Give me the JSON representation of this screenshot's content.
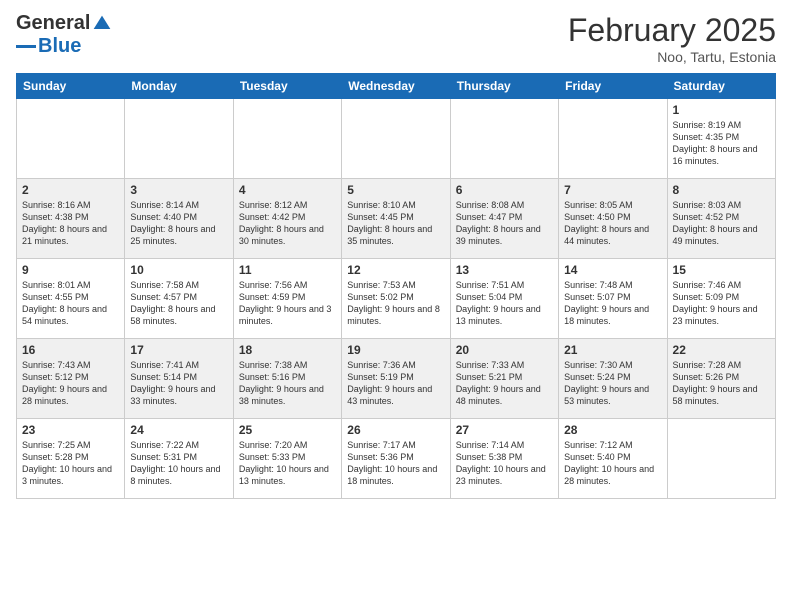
{
  "logo": {
    "general": "General",
    "blue": "Blue"
  },
  "title": "February 2025",
  "subtitle": "Noo, Tartu, Estonia",
  "days_of_week": [
    "Sunday",
    "Monday",
    "Tuesday",
    "Wednesday",
    "Thursday",
    "Friday",
    "Saturday"
  ],
  "weeks": [
    [
      {
        "day": "",
        "info": ""
      },
      {
        "day": "",
        "info": ""
      },
      {
        "day": "",
        "info": ""
      },
      {
        "day": "",
        "info": ""
      },
      {
        "day": "",
        "info": ""
      },
      {
        "day": "",
        "info": ""
      },
      {
        "day": "1",
        "info": "Sunrise: 8:19 AM\nSunset: 4:35 PM\nDaylight: 8 hours and 16 minutes."
      }
    ],
    [
      {
        "day": "2",
        "info": "Sunrise: 8:16 AM\nSunset: 4:38 PM\nDaylight: 8 hours and 21 minutes."
      },
      {
        "day": "3",
        "info": "Sunrise: 8:14 AM\nSunset: 4:40 PM\nDaylight: 8 hours and 25 minutes."
      },
      {
        "day": "4",
        "info": "Sunrise: 8:12 AM\nSunset: 4:42 PM\nDaylight: 8 hours and 30 minutes."
      },
      {
        "day": "5",
        "info": "Sunrise: 8:10 AM\nSunset: 4:45 PM\nDaylight: 8 hours and 35 minutes."
      },
      {
        "day": "6",
        "info": "Sunrise: 8:08 AM\nSunset: 4:47 PM\nDaylight: 8 hours and 39 minutes."
      },
      {
        "day": "7",
        "info": "Sunrise: 8:05 AM\nSunset: 4:50 PM\nDaylight: 8 hours and 44 minutes."
      },
      {
        "day": "8",
        "info": "Sunrise: 8:03 AM\nSunset: 4:52 PM\nDaylight: 8 hours and 49 minutes."
      }
    ],
    [
      {
        "day": "9",
        "info": "Sunrise: 8:01 AM\nSunset: 4:55 PM\nDaylight: 8 hours and 54 minutes."
      },
      {
        "day": "10",
        "info": "Sunrise: 7:58 AM\nSunset: 4:57 PM\nDaylight: 8 hours and 58 minutes."
      },
      {
        "day": "11",
        "info": "Sunrise: 7:56 AM\nSunset: 4:59 PM\nDaylight: 9 hours and 3 minutes."
      },
      {
        "day": "12",
        "info": "Sunrise: 7:53 AM\nSunset: 5:02 PM\nDaylight: 9 hours and 8 minutes."
      },
      {
        "day": "13",
        "info": "Sunrise: 7:51 AM\nSunset: 5:04 PM\nDaylight: 9 hours and 13 minutes."
      },
      {
        "day": "14",
        "info": "Sunrise: 7:48 AM\nSunset: 5:07 PM\nDaylight: 9 hours and 18 minutes."
      },
      {
        "day": "15",
        "info": "Sunrise: 7:46 AM\nSunset: 5:09 PM\nDaylight: 9 hours and 23 minutes."
      }
    ],
    [
      {
        "day": "16",
        "info": "Sunrise: 7:43 AM\nSunset: 5:12 PM\nDaylight: 9 hours and 28 minutes."
      },
      {
        "day": "17",
        "info": "Sunrise: 7:41 AM\nSunset: 5:14 PM\nDaylight: 9 hours and 33 minutes."
      },
      {
        "day": "18",
        "info": "Sunrise: 7:38 AM\nSunset: 5:16 PM\nDaylight: 9 hours and 38 minutes."
      },
      {
        "day": "19",
        "info": "Sunrise: 7:36 AM\nSunset: 5:19 PM\nDaylight: 9 hours and 43 minutes."
      },
      {
        "day": "20",
        "info": "Sunrise: 7:33 AM\nSunset: 5:21 PM\nDaylight: 9 hours and 48 minutes."
      },
      {
        "day": "21",
        "info": "Sunrise: 7:30 AM\nSunset: 5:24 PM\nDaylight: 9 hours and 53 minutes."
      },
      {
        "day": "22",
        "info": "Sunrise: 7:28 AM\nSunset: 5:26 PM\nDaylight: 9 hours and 58 minutes."
      }
    ],
    [
      {
        "day": "23",
        "info": "Sunrise: 7:25 AM\nSunset: 5:28 PM\nDaylight: 10 hours and 3 minutes."
      },
      {
        "day": "24",
        "info": "Sunrise: 7:22 AM\nSunset: 5:31 PM\nDaylight: 10 hours and 8 minutes."
      },
      {
        "day": "25",
        "info": "Sunrise: 7:20 AM\nSunset: 5:33 PM\nDaylight: 10 hours and 13 minutes."
      },
      {
        "day": "26",
        "info": "Sunrise: 7:17 AM\nSunset: 5:36 PM\nDaylight: 10 hours and 18 minutes."
      },
      {
        "day": "27",
        "info": "Sunrise: 7:14 AM\nSunset: 5:38 PM\nDaylight: 10 hours and 23 minutes."
      },
      {
        "day": "28",
        "info": "Sunrise: 7:12 AM\nSunset: 5:40 PM\nDaylight: 10 hours and 28 minutes."
      },
      {
        "day": "",
        "info": ""
      }
    ]
  ]
}
